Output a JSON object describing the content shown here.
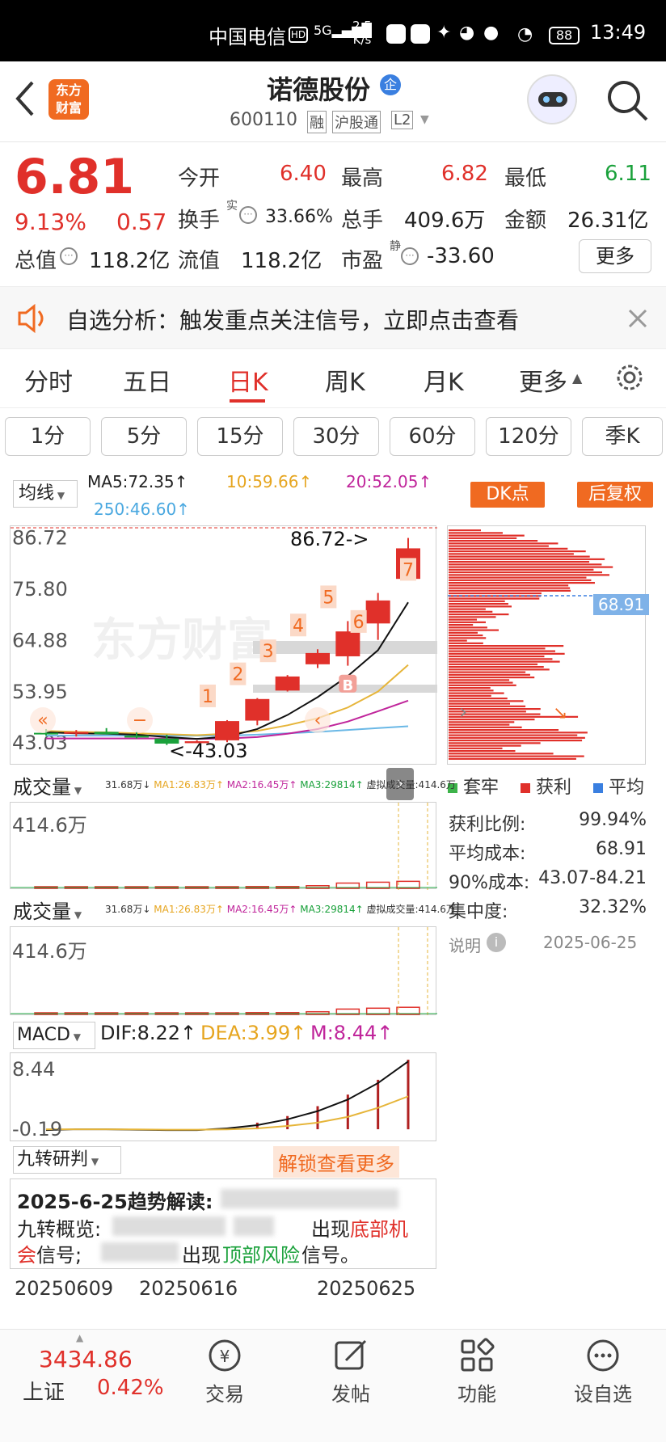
{
  "status_bar": {
    "carrier": "中国电信",
    "net_speed_top": "2.5",
    "net_speed_unit": "K/s",
    "battery": "88",
    "time": "13:49"
  },
  "header": {
    "logo_text": "东方\n财富",
    "stock_name": "诺德股份",
    "corp_badge": "企",
    "code": "600110",
    "tags": [
      "融",
      "沪股通",
      "L2"
    ]
  },
  "quote": {
    "price": "6.81",
    "change_pct": "9.13%",
    "change": "0.57",
    "rows": [
      [
        {
          "label": "今开",
          "value": "6.40",
          "color": "#e0302a"
        },
        {
          "label": "最高",
          "value": "6.82",
          "color": "#e0302a"
        },
        {
          "label": "最低",
          "value": "6.11",
          "color": "#1aa13b"
        }
      ],
      [
        {
          "label": "换手",
          "value": "33.66%",
          "color": "#222"
        },
        {
          "label": "总手",
          "value": "409.6万",
          "color": "#222"
        },
        {
          "label": "金额",
          "value": "26.31亿",
          "color": "#222"
        }
      ],
      [
        {
          "label": "总值",
          "value": "118.2亿",
          "color": "#222"
        },
        {
          "label": "流值",
          "value": "118.2亿",
          "color": "#222"
        },
        {
          "label": "市盈",
          "value": "-33.60",
          "color": "#222"
        }
      ]
    ],
    "turnover_sup": "实",
    "pe_sup": "静",
    "more_button": "更多"
  },
  "notice": {
    "text": "自选分析：触发重点关注信号，立即点击查看"
  },
  "tabs": [
    "分时",
    "五日",
    "日K",
    "周K",
    "月K",
    "更多"
  ],
  "active_tab": "日K",
  "periods": [
    "1分",
    "5分",
    "15分",
    "30分",
    "60分",
    "120分",
    "季K"
  ],
  "ma_header": {
    "selector": "均线",
    "ma5": "MA5:72.35↑",
    "ma10": "10:59.66↑",
    "ma20": "20:52.05↑",
    "ma250": "250:46.60↑",
    "dk_button": "DK点",
    "fq_button": "后复权"
  },
  "kline": {
    "y_labels": [
      "86.72",
      "75.80",
      "64.88",
      "53.95",
      "43.03"
    ],
    "max_annotation": "86.72->",
    "min_annotation": "<-43.03",
    "markers": [
      "1",
      "2",
      "3",
      "4",
      "5",
      "6",
      "7"
    ],
    "b_marker": "B",
    "watermark": "东方财富",
    "candles": [
      {
        "o": 45.2,
        "h": 46.0,
        "l": 44.6,
        "c": 45.0
      },
      {
        "o": 45.0,
        "h": 45.8,
        "l": 44.4,
        "c": 45.4
      },
      {
        "o": 45.4,
        "h": 46.2,
        "l": 44.8,
        "c": 44.9
      },
      {
        "o": 44.6,
        "h": 45.4,
        "l": 44.0,
        "c": 44.2
      },
      {
        "o": 44.0,
        "h": 44.8,
        "l": 42.6,
        "c": 42.9
      },
      {
        "o": 43.0,
        "h": 43.6,
        "l": 43.03,
        "c": 43.4
      },
      {
        "o": 43.6,
        "h": 47.9,
        "l": 43.2,
        "c": 47.7
      },
      {
        "o": 47.8,
        "h": 52.6,
        "l": 46.8,
        "c": 52.4
      },
      {
        "o": 54.2,
        "h": 57.5,
        "l": 54.0,
        "c": 57.2
      },
      {
        "o": 59.8,
        "h": 63.0,
        "l": 59.0,
        "c": 62.2
      },
      {
        "o": 61.5,
        "h": 69.0,
        "l": 59.5,
        "c": 66.8
      },
      {
        "o": 68.5,
        "h": 75.0,
        "l": 65.0,
        "c": 73.4
      },
      {
        "o": 78.0,
        "h": 86.72,
        "l": 79.0,
        "c": 84.5
      }
    ],
    "ma_lines": {
      "ma5": [
        45.3,
        45.1,
        45.0,
        44.8,
        44.3,
        43.9,
        44.4,
        46.0,
        49.0,
        52.8,
        57.3,
        62.8,
        73.0
      ],
      "ma10": [
        45.6,
        45.4,
        45.3,
        45.1,
        44.9,
        44.7,
        45.0,
        45.6,
        46.8,
        48.3,
        50.6,
        54.0,
        59.66
      ],
      "ma20": [
        44.0,
        44.0,
        44.0,
        44.0,
        44.0,
        43.9,
        44.0,
        44.3,
        45.0,
        46.0,
        47.6,
        49.8,
        52.05
      ],
      "ma250": [
        44.6,
        44.6,
        44.6,
        44.6,
        44.6,
        44.6,
        44.6,
        44.8,
        45.1,
        45.4,
        45.8,
        46.2,
        46.6
      ]
    },
    "y_range": [
      41.0,
      87.5
    ]
  },
  "chip": {
    "avg_cost_label": "68.91",
    "legend": [
      "套牢",
      "获利",
      "平均"
    ],
    "legend_colors": [
      "#3db34a",
      "#e0302a",
      "#3a7fe0"
    ],
    "stats": [
      {
        "label": "获利比例:",
        "value": "99.94%"
      },
      {
        "label": "平均成本:",
        "value": "68.91"
      },
      {
        "label": "90%成本:",
        "value": "43.07-84.21"
      },
      {
        "label": "集中度:",
        "value": "32.32%"
      }
    ],
    "note_label": "说明",
    "date": "2025-06-25"
  },
  "volume": {
    "selector": "成交量",
    "info": [
      "31.68万↓",
      "MA1:26.83万↑",
      "MA2:16.45万↑",
      "MA3:29814↑",
      "虚拟成交量:414.6万"
    ],
    "y_label": "414.6万"
  },
  "macd": {
    "selector": "MACD",
    "dif": "DIF:8.22↑",
    "dea": "DEA:3.99↑",
    "m": "M:8.44↑",
    "y_top": "8.44",
    "y_bottom": "-0.19"
  },
  "nine": {
    "selector": "九转研判",
    "unlock": "解锁查看更多",
    "title": "2025-6-25趋势解读:",
    "line2_a": "九转概览:",
    "line2_b": "出现",
    "line2_c": "底部机",
    "line3_a": "会",
    "line3_b": "信号;",
    "line3_c": "出现",
    "line3_d": "顶部风险",
    "line3_e": "信号。"
  },
  "x_dates": [
    "20250609",
    "20250616",
    "20250625"
  ],
  "bottom_nav": {
    "index_value": "3434.86",
    "index_name": "上证",
    "index_change": "0.42%",
    "items": [
      "交易",
      "发帖",
      "功能",
      "设自选"
    ]
  }
}
